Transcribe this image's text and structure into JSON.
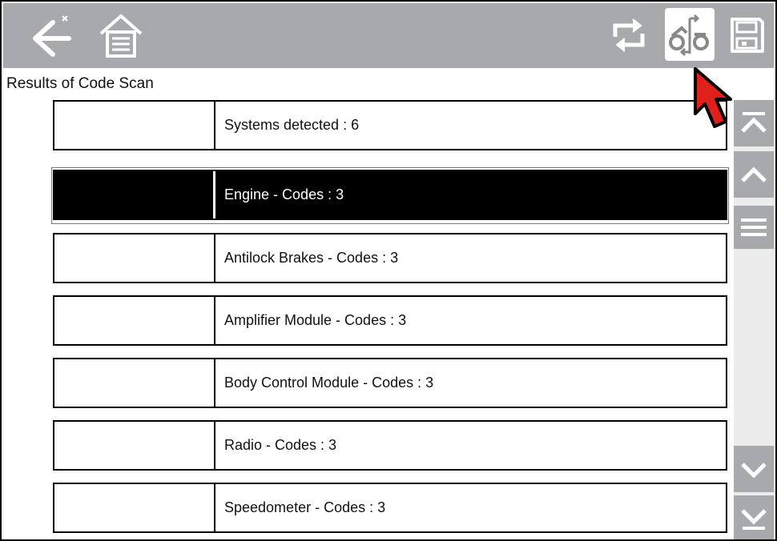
{
  "toolbar": {
    "icons": [
      "back-arrow-icon",
      "home-icon",
      "refresh-icon",
      "vehicle-system-icon",
      "save-icon"
    ],
    "highlight_color": "#ffffff",
    "background_color": "#a7a9ac"
  },
  "page": {
    "title": "Results of Code Scan"
  },
  "results": {
    "rows": [
      {
        "label": "Systems detected : 6",
        "selected": false
      },
      {
        "label": "Engine - Codes : 3",
        "selected": true
      },
      {
        "label": "Antilock Brakes - Codes : 3",
        "selected": false
      },
      {
        "label": "Amplifier Module - Codes : 3",
        "selected": false
      },
      {
        "label": "Body Control Module - Codes : 3",
        "selected": false
      },
      {
        "label": "Radio - Codes : 3",
        "selected": false
      },
      {
        "label": "Speedometer - Codes : 3",
        "selected": false
      }
    ]
  },
  "scrollbar": {
    "icons": [
      "scroll-top-icon",
      "scroll-up-icon",
      "scroll-thumb-icon",
      "scroll-down-icon",
      "scroll-bottom-icon"
    ]
  },
  "annotation": {
    "pointer_color": "#e0201b",
    "icon": "pointer-arrow-icon"
  }
}
